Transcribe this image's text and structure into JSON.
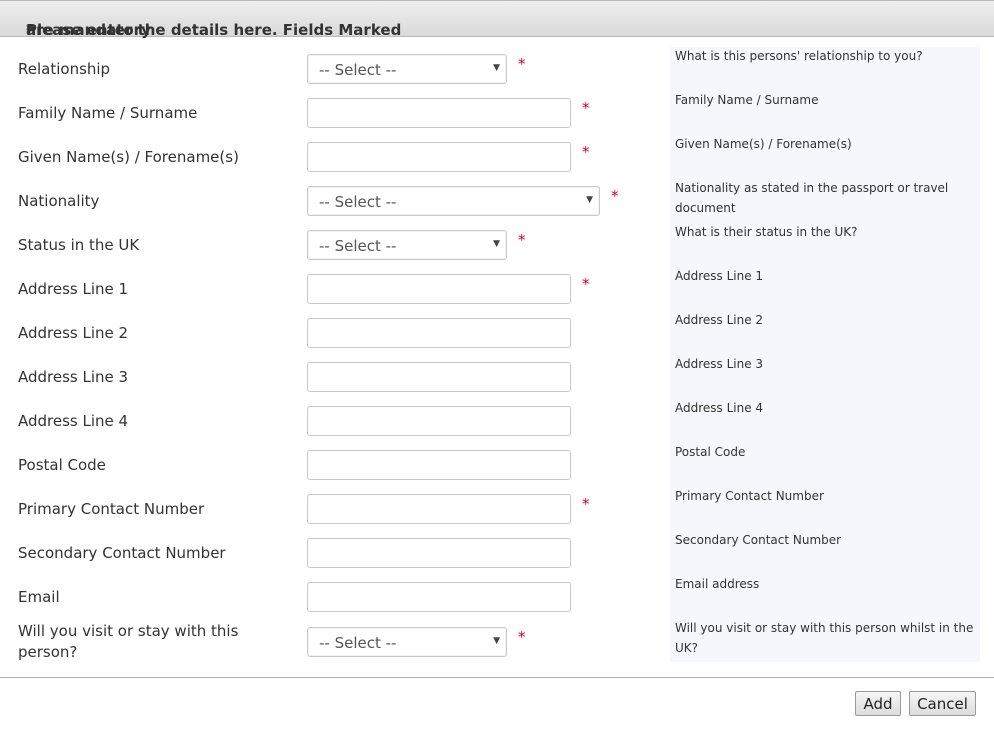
{
  "header": {
    "text_before": "Please enter the details here. Fields Marked ",
    "star": "*",
    "text_after": " are mandatory"
  },
  "required_mark": "*",
  "fields": [
    {
      "label": "Relationship",
      "type": "select",
      "value": "-- Select --",
      "required": true,
      "help": "What is this persons' relationship to you?"
    },
    {
      "label": "Family Name / Surname",
      "type": "text",
      "value": "",
      "required": true,
      "help": "Family Name / Surname"
    },
    {
      "label": "Given Name(s) / Forename(s)",
      "type": "text",
      "value": "",
      "required": true,
      "help": "Given Name(s) / Forename(s)"
    },
    {
      "label": "Nationality",
      "type": "select",
      "value": "-- Select --",
      "required": true,
      "help": "Nationality as stated in the passport or travel document"
    },
    {
      "label": "Status in the UK",
      "type": "select",
      "value": "-- Select --",
      "required": true,
      "help": "What is their status in the UK?"
    },
    {
      "label": "Address Line 1",
      "type": "text",
      "value": "",
      "required": true,
      "help": "Address Line 1"
    },
    {
      "label": "Address Line 2",
      "type": "text",
      "value": "",
      "required": false,
      "help": "Address Line 2"
    },
    {
      "label": "Address Line 3",
      "type": "text",
      "value": "",
      "required": false,
      "help": "Address Line 3"
    },
    {
      "label": "Address Line 4",
      "type": "text",
      "value": "",
      "required": false,
      "help": "Address Line 4"
    },
    {
      "label": "Postal Code",
      "type": "text",
      "value": "",
      "required": false,
      "help": "Postal Code"
    },
    {
      "label": "Primary Contact Number",
      "type": "text",
      "value": "",
      "required": true,
      "help": "Primary Contact Number"
    },
    {
      "label": "Secondary Contact Number",
      "type": "text",
      "value": "",
      "required": false,
      "help": "Secondary Contact Number"
    },
    {
      "label": "Email",
      "type": "text",
      "value": "",
      "required": false,
      "help": "Email address"
    },
    {
      "label": "Will you visit or stay with this person?",
      "type": "select",
      "value": "-- Select --",
      "required": true,
      "help": "Will you visit or stay with this person whilst in the UK?"
    }
  ],
  "buttons": {
    "add": "Add",
    "cancel": "Cancel"
  },
  "icons": {
    "dropdown": "▼"
  }
}
